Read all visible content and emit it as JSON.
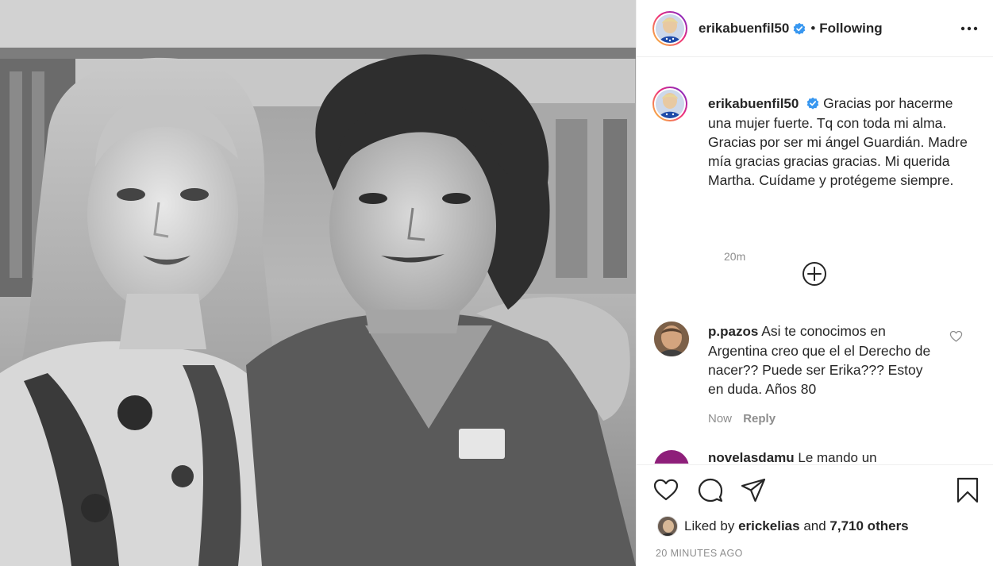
{
  "post": {
    "username": "erikabuenfil50",
    "follow_status": "Following",
    "dot": "•"
  },
  "caption": {
    "username": "erikabuenfil50",
    "text": "Gracias por hacerme una mujer fuerte. Tq con toda mi alma. Gracias por ser mi ángel Guardián. Madre mía gracias gracias gracias. Mi querida Martha. Cuídame y protégeme siempre.",
    "time": "20m"
  },
  "comments": [
    {
      "username": "p.pazos",
      "text": "Asi te conocimos en Argentina creo que el el Derecho de nacer?? Puede ser Erika??? Estoy en duda. Años 80",
      "time": "Now",
      "reply_label": "Reply"
    },
    {
      "username": "novelasdamu",
      "text": "Le mando un"
    }
  ],
  "likes": {
    "prefix": "Liked by",
    "user": "erickelias",
    "joiner": "and",
    "others": "7,710 others"
  },
  "timestamp": "20 MINUTES AGO",
  "icons": {
    "more": "more-options-icon",
    "verified": "verified-badge-icon",
    "like": "heart-icon",
    "comment": "comment-bubble-icon",
    "share": "paper-plane-icon",
    "save": "bookmark-icon",
    "load_more": "plus-circle-icon"
  },
  "colors": {
    "verified": "#3897f0",
    "text": "#262626",
    "muted": "#8e8e8e",
    "border": "#efefef"
  }
}
